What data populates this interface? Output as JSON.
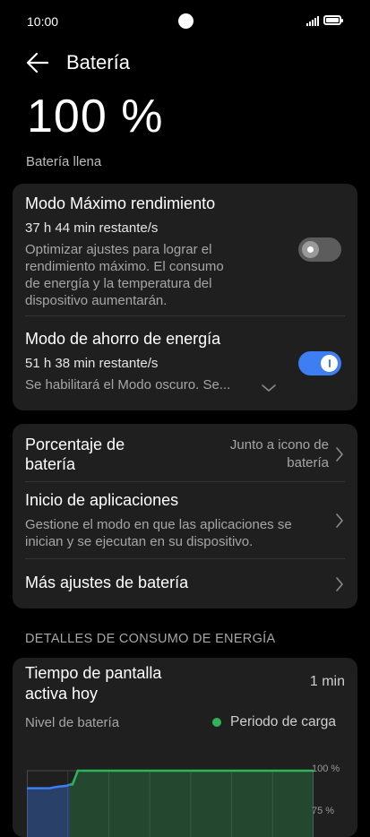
{
  "status_bar": {
    "time": "10:00"
  },
  "header": {
    "title": "Batería"
  },
  "battery": {
    "level": "100 %",
    "state": "Batería llena"
  },
  "modes": [
    {
      "title": "Modo Máximo rendimiento",
      "remaining": "37 h 44 min restante/s",
      "description": [
        "Optimizar ajustes para lograr el",
        "rendimiento máximo. El consumo",
        "de energía y la temperatura del",
        "dispositivo aumentarán."
      ],
      "enabled": false
    },
    {
      "title": "Modo de ahorro de energía",
      "remaining": "51 h 38 min restante/s",
      "description": [
        "Se habilitará el Modo oscuro. Se..."
      ],
      "enabled": true
    }
  ],
  "settings": {
    "percentage": {
      "label_1": "Porcentaje de",
      "label_2": "batería",
      "value_1": "Junto a icono de",
      "value_2": "batería"
    },
    "app_launch": {
      "label": "Inicio de aplicaciones",
      "desc_1": "Gestione el modo en que las aplicaciones se",
      "desc_2": "inician y se ejecutan en su dispositivo."
    },
    "more": {
      "label": "Más ajustes de batería"
    }
  },
  "details": {
    "section_title": "DETALLES DE CONSUMO DE ENERGÍA",
    "screen_time_1": "Tiempo de pantalla",
    "screen_time_2": "activa hoy",
    "screen_time_value": "1 min",
    "battery_level_label": "Nivel de batería",
    "charging_legend": "Periodo de carga"
  },
  "chart_data": {
    "type": "area",
    "y_ticks": [
      "100 %",
      "75 %"
    ],
    "ylim": [
      75,
      100
    ],
    "series": [
      {
        "name": "Periodo de carga",
        "color": "#2fb35a",
        "segment": "charging",
        "x": [
          0.19,
          1.0
        ],
        "values": [
          100,
          100
        ]
      },
      {
        "segment": "discharging",
        "color": "#3d7ef3",
        "x": [
          0.0,
          0.08,
          0.1,
          0.14,
          0.15
        ],
        "values": [
          93,
          93,
          93.5,
          94,
          94.5
        ]
      }
    ],
    "colors": {
      "charging": "#2fb35a",
      "normal": "#3d7ef3"
    }
  }
}
